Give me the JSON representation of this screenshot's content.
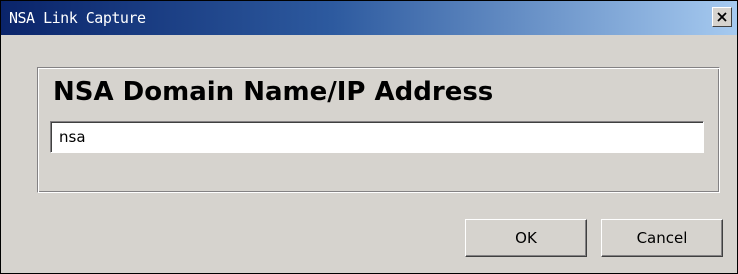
{
  "window": {
    "title": "NSA Link Capture"
  },
  "form": {
    "label": "NSA Domain Name/IP Address",
    "input_value": "nsa"
  },
  "buttons": {
    "ok_label": "OK",
    "cancel_label": "Cancel"
  },
  "icons": {
    "close": "close-icon"
  },
  "colors": {
    "titlebar_start": "#0a246a",
    "titlebar_end": "#a6caf0",
    "dialog_background": "#d6d3ce"
  }
}
